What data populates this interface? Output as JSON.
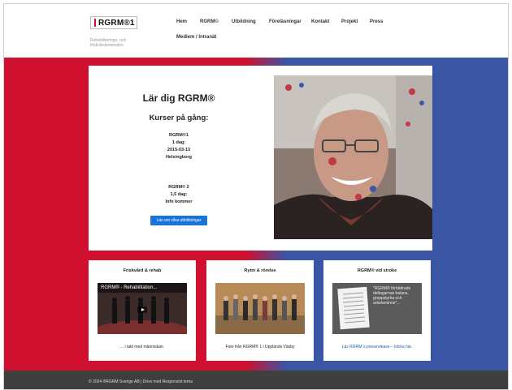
{
  "header": {
    "logo_text": "RGRM®1",
    "tagline": "Rehabiliterings- och friskvårdsmetoden",
    "nav": [
      {
        "label": "Hem"
      },
      {
        "label": "RGRM©"
      },
      {
        "label": "Utbildning"
      },
      {
        "label": "Föreläsningar"
      },
      {
        "label": "Kontakt"
      },
      {
        "label": "Projekt"
      },
      {
        "label": "Press"
      },
      {
        "label": "Medlem / Intranät"
      }
    ]
  },
  "hero": {
    "title": "Lär dig RGRM®",
    "subtitle": "Kurser på gång:",
    "course1": [
      "RGRM©1",
      "1 dag:",
      "2015-03-13",
      "Helsingborg"
    ],
    "course2": [
      "RGRM© 2",
      "1,5 dag:",
      "Info kommer"
    ],
    "cta_label": "Läs om våra utbildningar",
    "portrait_icon": "portrait-photo"
  },
  "cards": [
    {
      "title": "Friskvård & rehab",
      "video_title": "RGRM® - Rehabilitation...",
      "caption": "... i takt med människan."
    },
    {
      "title": "Rytm & rörelse",
      "caption": "Foto från RGRM® 1 i Upplands Väsby"
    },
    {
      "title": "RGRM® vid stroke",
      "quote": "\"RGRM® förbättrade deltagarnas balans, greppstyrka och arbetsminne\"...",
      "caption": "Läs RGRM´s pressrelease – klicka här."
    }
  ],
  "footer": {
    "text": "© 2024 ®RGRM Sverige AB | Drivs med Responsivt tema"
  },
  "colors": {
    "brand_red": "#d0102e",
    "brand_blue": "#3a55a3",
    "cta_blue": "#1a73d9",
    "footer_bg": "#3f3f3f"
  }
}
